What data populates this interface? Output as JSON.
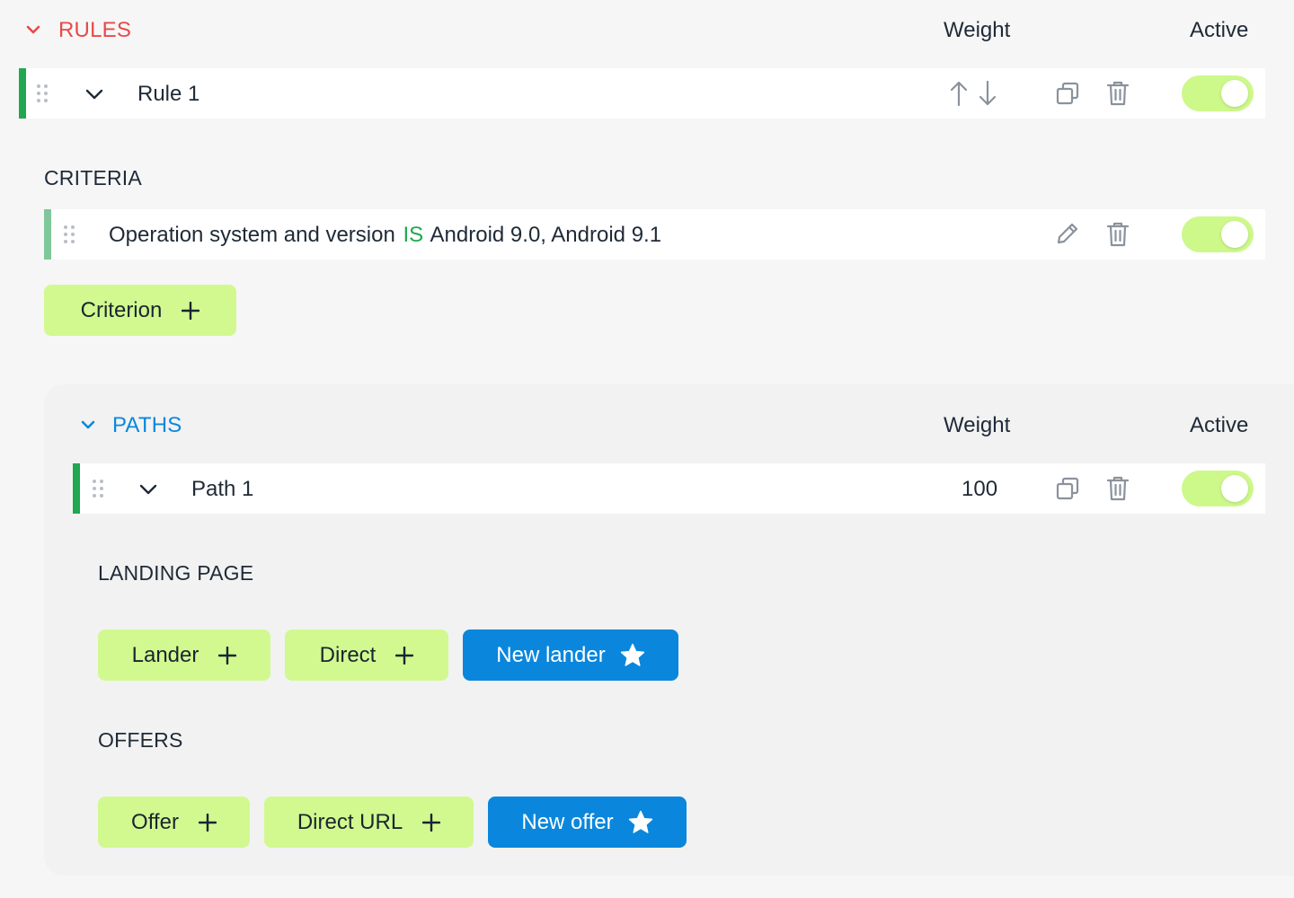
{
  "colors": {
    "rules_accent": "#e8494a",
    "paths_accent": "#0a87dc",
    "active_bar": "#1fa84f",
    "criteria_bar": "#7fc79a",
    "toggle_on": "#cdf88a",
    "button_green": "#d1f98f",
    "button_blue": "#0a87dc"
  },
  "rules": {
    "title": "RULES",
    "weight_header": "Weight",
    "active_header": "Active",
    "rule": {
      "label": "Rule 1",
      "active": true
    }
  },
  "criteria": {
    "title": "CRITERIA",
    "item": {
      "field": "Operation system and version",
      "operator": "IS",
      "value": "Android 9.0, Android 9.1",
      "active": true
    },
    "add_button": "Criterion"
  },
  "paths": {
    "title": "PATHS",
    "weight_header": "Weight",
    "active_header": "Active",
    "path": {
      "label": "Path 1",
      "weight": "100",
      "active": true
    }
  },
  "landing_page": {
    "title": "LANDING PAGE",
    "buttons": {
      "lander": "Lander",
      "direct": "Direct",
      "new_lander": "New lander"
    }
  },
  "offers": {
    "title": "OFFERS",
    "buttons": {
      "offer": "Offer",
      "direct_url": "Direct URL",
      "new_offer": "New offer"
    }
  },
  "icons": [
    "chevron-down-icon",
    "drag-handle-icon",
    "arrow-up-icon",
    "arrow-down-icon",
    "copy-icon",
    "trash-icon",
    "pencil-icon",
    "plus-icon",
    "star-icon"
  ]
}
